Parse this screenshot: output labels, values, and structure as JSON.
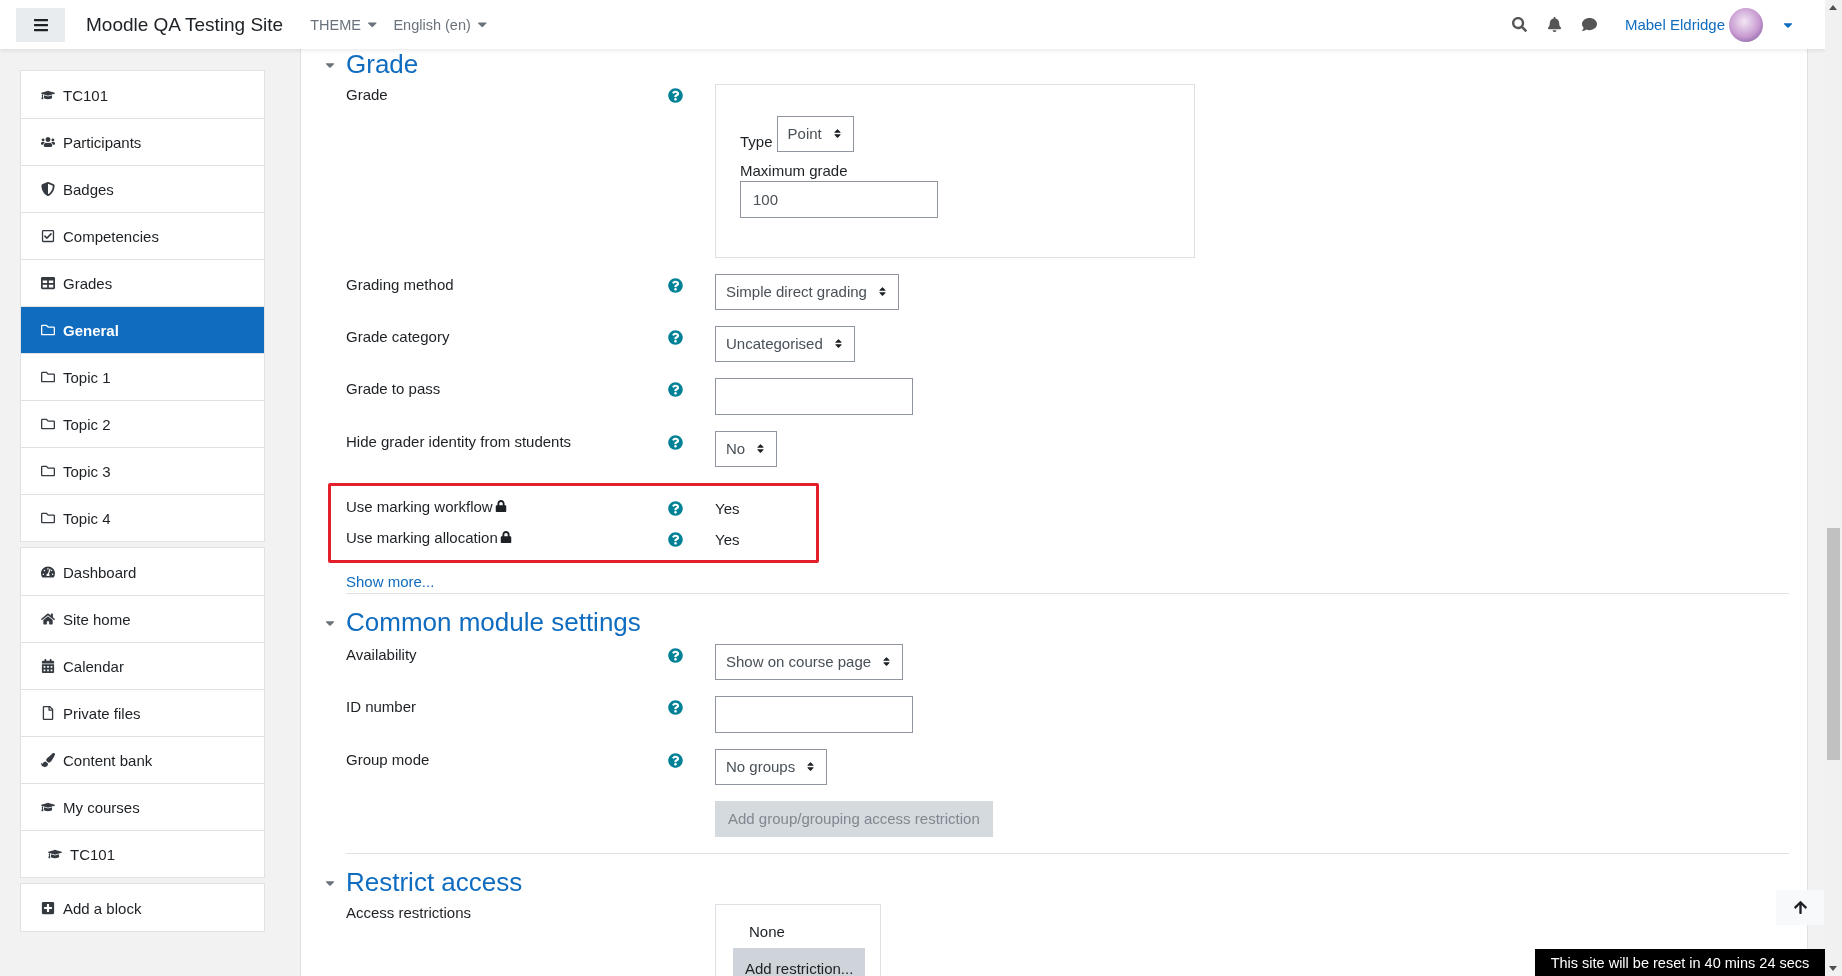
{
  "navbar": {
    "site_name": "Moodle QA Testing Site",
    "menus": [
      "THEME",
      "English (en)"
    ],
    "user_name": "Mabel Eldridge"
  },
  "sidebar": {
    "blocks": [
      {
        "items": [
          {
            "label": "TC101",
            "selected": false
          },
          {
            "label": "Participants",
            "selected": false
          },
          {
            "label": "Badges",
            "selected": false
          },
          {
            "label": "Competencies",
            "selected": false
          },
          {
            "label": "Grades",
            "selected": false
          },
          {
            "label": "General",
            "selected": true
          },
          {
            "label": "Topic 1",
            "selected": false
          },
          {
            "label": "Topic 2",
            "selected": false
          },
          {
            "label": "Topic 3",
            "selected": false
          },
          {
            "label": "Topic 4",
            "selected": false
          }
        ]
      },
      {
        "items": [
          {
            "label": "Dashboard",
            "selected": false
          },
          {
            "label": "Site home",
            "selected": false
          },
          {
            "label": "Calendar",
            "selected": false
          },
          {
            "label": "Private files",
            "selected": false
          },
          {
            "label": "Content bank",
            "selected": false
          },
          {
            "label": "My courses",
            "selected": false,
            "children": [
              {
                "label": "TC101",
                "selected": false
              }
            ]
          }
        ]
      },
      {
        "items": [
          {
            "label": "Add a block",
            "selected": false
          }
        ]
      }
    ]
  },
  "sections": [
    {
      "title": "Grade",
      "expanded": true,
      "items": [
        {
          "kind": "grade",
          "label": "Grade",
          "help": true,
          "type_label": "Type",
          "type_value": "Point",
          "max_label": "Maximum grade",
          "max_value": "100"
        },
        {
          "kind": "select",
          "label": "Grading method",
          "help": true,
          "value": "Simple direct grading"
        },
        {
          "kind": "select",
          "label": "Grade category",
          "help": true,
          "value": "Uncategorised"
        },
        {
          "kind": "text",
          "label": "Grade to pass",
          "help": true
        },
        {
          "kind": "select",
          "label": "Hide grader identity from students",
          "help": true,
          "value": "No"
        },
        {
          "kind": "highlight",
          "rows": [
            {
              "kind": "static",
              "label": "Use marking workflow",
              "locked": true,
              "help": true,
              "value": "Yes"
            },
            {
              "kind": "static",
              "label": "Use marking allocation",
              "locked": true,
              "help": true,
              "value": "Yes"
            }
          ]
        }
      ],
      "more_link": "Show more..."
    },
    {
      "title": "Common module settings",
      "expanded": true,
      "items": [
        {
          "kind": "select",
          "label": "Availability",
          "help": true,
          "value": "Show on course page"
        },
        {
          "kind": "text",
          "label": "ID number",
          "help": true
        },
        {
          "kind": "select",
          "label": "Group mode",
          "help": true,
          "value": "No groups"
        },
        {
          "kind": "button",
          "label": "Add group/grouping access restriction",
          "disabled": true
        }
      ]
    },
    {
      "title": "Restrict access",
      "expanded": true,
      "items": [
        {
          "kind": "restrictions",
          "label": "Access restrictions",
          "help": false,
          "status": "None",
          "button": "Add restriction..."
        }
      ]
    }
  ],
  "reset_notice": "This site will be reset in 40 mins 24 secs"
}
